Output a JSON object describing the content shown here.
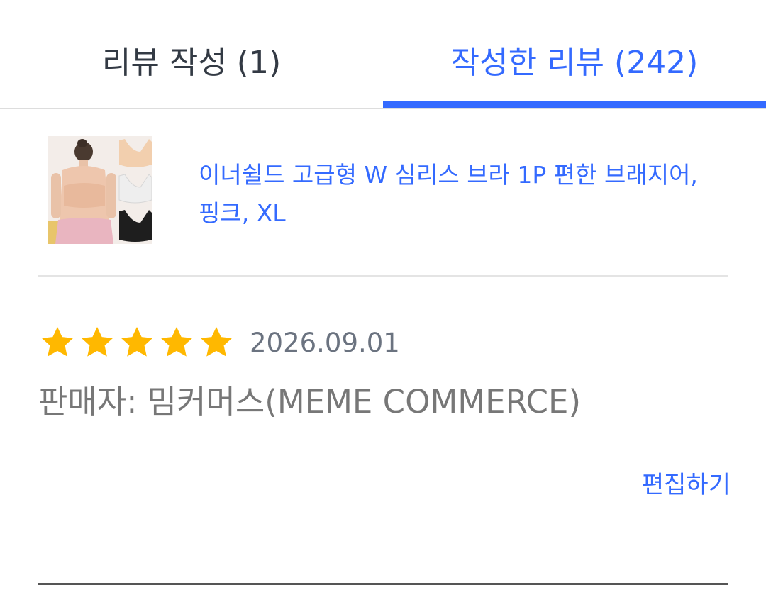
{
  "tabs": {
    "write": "리뷰 작성 (1)",
    "written": "작성한 리뷰 (242)"
  },
  "product": {
    "name": "이너쉴드 고급형 W 심리스 브라 1P 편한 브래지어, 핑크, XL"
  },
  "review": {
    "rating": 5,
    "rating_max": 5,
    "date": "2026.09.01",
    "seller": "판매자: 밈커머스(MEME COMMERCE)",
    "edit_label": "편집하기"
  },
  "colors": {
    "accent": "#346aff",
    "star": "#ffb800"
  }
}
